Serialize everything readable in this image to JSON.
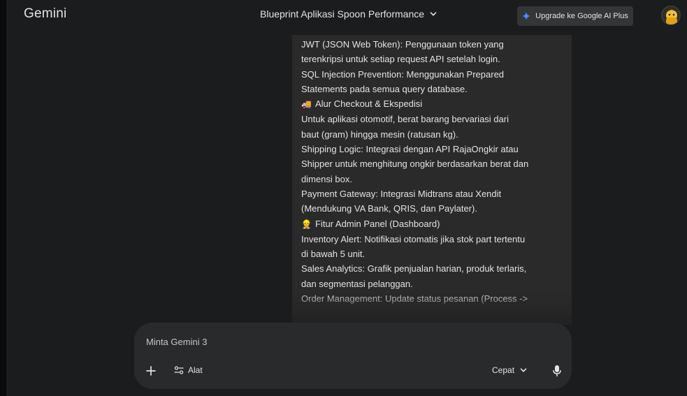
{
  "header": {
    "app_title": "Gemini",
    "conversation_title": "Blueprint Aplikasi Spoon Performance",
    "upgrade_label": "Upgrade ke Google AI Plus"
  },
  "response": {
    "lines": [
      {
        "icon": "",
        "text": "JWT (JSON Web Token): Penggunaan token yang"
      },
      {
        "icon": "",
        "text": "terenkripsi untuk setiap request API setelah login."
      },
      {
        "icon": "",
        "text": "SQL Injection Prevention: Menggunakan Prepared"
      },
      {
        "icon": "",
        "text": "Statements pada semua query database."
      },
      {
        "icon": "🚚",
        "text": "Alur Checkout & Ekspedisi"
      },
      {
        "icon": "",
        "text": "Untuk aplikasi otomotif, berat barang bervariasi dari"
      },
      {
        "icon": "",
        "text": "baut (gram) hingga mesin (ratusan kg)."
      },
      {
        "icon": "",
        "text": "Shipping Logic: Integrasi dengan API RajaOngkir atau"
      },
      {
        "icon": "",
        "text": "Shipper untuk menghitung ongkir berdasarkan berat dan"
      },
      {
        "icon": "",
        "text": "dimensi box."
      },
      {
        "icon": "",
        "text": "Payment Gateway: Integrasi Midtrans atau Xendit"
      },
      {
        "icon": "",
        "text": "(Mendukung VA Bank, QRIS, dan Paylater)."
      },
      {
        "icon": "👷",
        "text": "Fitur Admin Panel (Dashboard)"
      },
      {
        "icon": "",
        "text": "Inventory Alert: Notifikasi otomatis jika stok part tertentu"
      },
      {
        "icon": "",
        "text": "di bawah 5 unit."
      },
      {
        "icon": "",
        "text": "Sales Analytics: Grafik penjualan harian, produk terlaris,"
      },
      {
        "icon": "",
        "text": "dan segmentasi pelanggan."
      },
      {
        "icon": "",
        "text": "Order Management: Update status pesanan (Process ->"
      }
    ]
  },
  "composer": {
    "placeholder": "Minta Gemini 3",
    "tools_label": "Alat",
    "mode_label": "Cepat"
  },
  "colors": {
    "background": "#1b1c1d",
    "response_bg": "#2a2a2a",
    "composer_bg": "#282a2c",
    "upgrade_bg": "#333537",
    "sparkle_blue": "#4a8cff"
  }
}
